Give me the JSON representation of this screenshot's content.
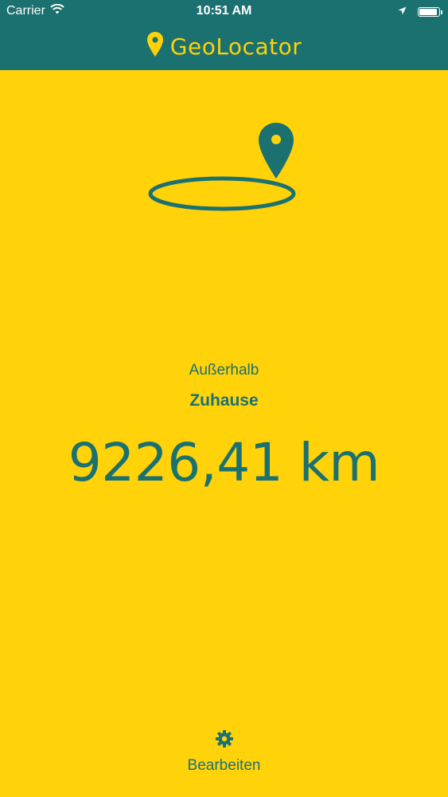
{
  "status_bar": {
    "carrier": "Carrier",
    "time": "10:51 AM",
    "battery_level": 0.9
  },
  "nav": {
    "title": "GeoLocator",
    "title_icon": "map-pin-icon"
  },
  "main": {
    "hero_icon": "geofence-pin-icon",
    "status_label": "Außerhalb",
    "place_name": "Zuhause",
    "distance": "9226,41 km"
  },
  "toolbar": {
    "edit_icon": "gear-icon",
    "edit_label": "Bearbeiten"
  },
  "colors": {
    "background": "#FFD20A",
    "accent": "#1B7170",
    "status_text": "#FFFFFF"
  }
}
